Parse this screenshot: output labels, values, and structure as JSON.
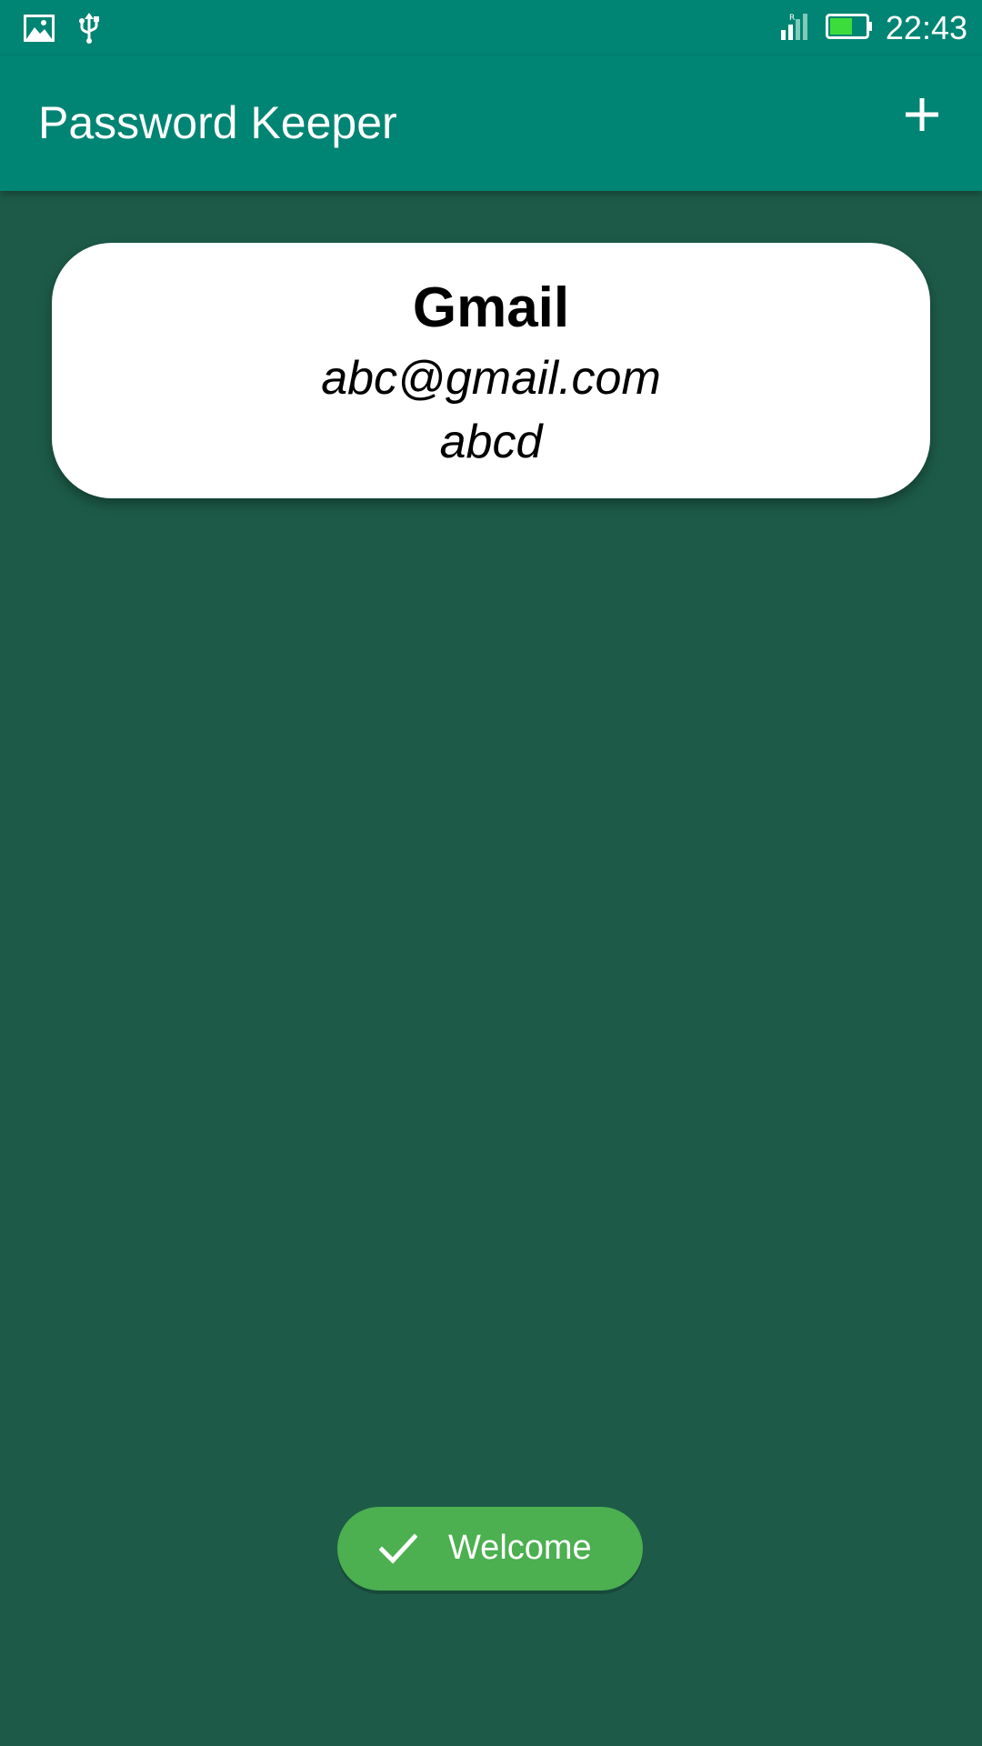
{
  "status_bar": {
    "time": "22:43",
    "icons": [
      "image-icon",
      "usb-icon",
      "signal-icon",
      "battery-icon"
    ],
    "battery_color": "#3ddc3d"
  },
  "app_bar": {
    "title": "Password Keeper",
    "action_icon": "plus-icon",
    "background_color": "#008473"
  },
  "entries": [
    {
      "name": "Gmail",
      "email": "abc@gmail.com",
      "password": "abcd"
    }
  ],
  "toast": {
    "icon": "check-icon",
    "message": "Welcome",
    "background_color": "#4caf50"
  },
  "colors": {
    "background": "#1d5b48",
    "card": "#ffffff"
  }
}
